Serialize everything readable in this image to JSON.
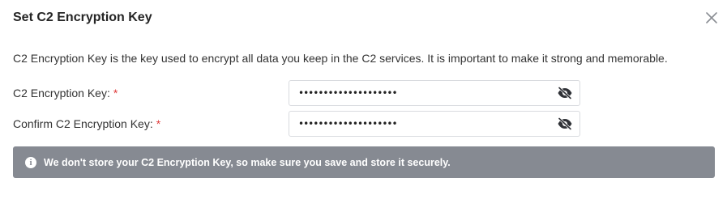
{
  "dialog": {
    "title": "Set C2 Encryption Key",
    "close_icon": "close-icon",
    "description": "C2 Encryption Key is the key used to encrypt all data you keep in the C2 services. It is important to make it strong and memorable."
  },
  "fields": [
    {
      "label": "C2 Encryption Key:",
      "required_mark": "*",
      "value": "••••••••••••••••••••",
      "type": "password",
      "toggle_icon": "eye-slash-icon"
    },
    {
      "label": "Confirm C2 Encryption Key:",
      "required_mark": "*",
      "value": "••••••••••••••••••••",
      "type": "password",
      "toggle_icon": "eye-slash-icon"
    }
  ],
  "notice": {
    "icon": "info-icon",
    "icon_glyph": "i",
    "text": "We don't store your C2 Encryption Key, so make sure you save and store it securely."
  },
  "colors": {
    "required": "#e03c3c",
    "notice_bg": "#868a92",
    "border": "#d9dbdf"
  }
}
